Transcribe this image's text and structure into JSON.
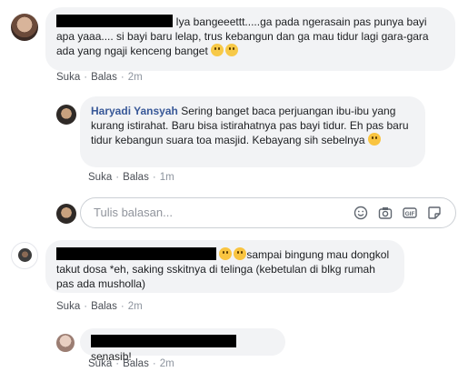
{
  "comment1": {
    "text": "Iya bangeeettt.....ga pada ngerasain pas punya bayi apa yaaa.... si bayi baru lelap, trus kebangun dan ga mau tidur lagi gara-gara ada yang ngaji kenceng banget",
    "actions": {
      "like": "Suka",
      "reply": "Balas",
      "time": "2m"
    }
  },
  "reply1": {
    "author": "Haryadi Yansyah",
    "text": "Sering banget baca perjuangan ibu-ibu yang kurang istirahat. Baru bisa istirahatnya pas bayi tidur. Eh pas baru tidur kebangun suara toa masjid. Kebayang sih sebelnya",
    "actions": {
      "like": "Suka",
      "reply": "Balas",
      "time": "1m"
    }
  },
  "reply_input": {
    "placeholder": "Tulis balasan..."
  },
  "reply_tools": [
    "emoji-icon",
    "camera-icon",
    "gif-icon",
    "sticker-icon"
  ],
  "comment2": {
    "text_line1": "sampai bingung mau dongkol takut",
    "text_rest": "dosa *eh, saking sskitnya di telinga (kebetulan di blkg rumah pas ada musholla)",
    "actions": {
      "like": "Suka",
      "reply": "Balas",
      "time": "2m"
    }
  },
  "comment3": {
    "text": "senasib!",
    "actions": {
      "like": "Suka",
      "reply": "Balas",
      "time": "2m"
    }
  }
}
